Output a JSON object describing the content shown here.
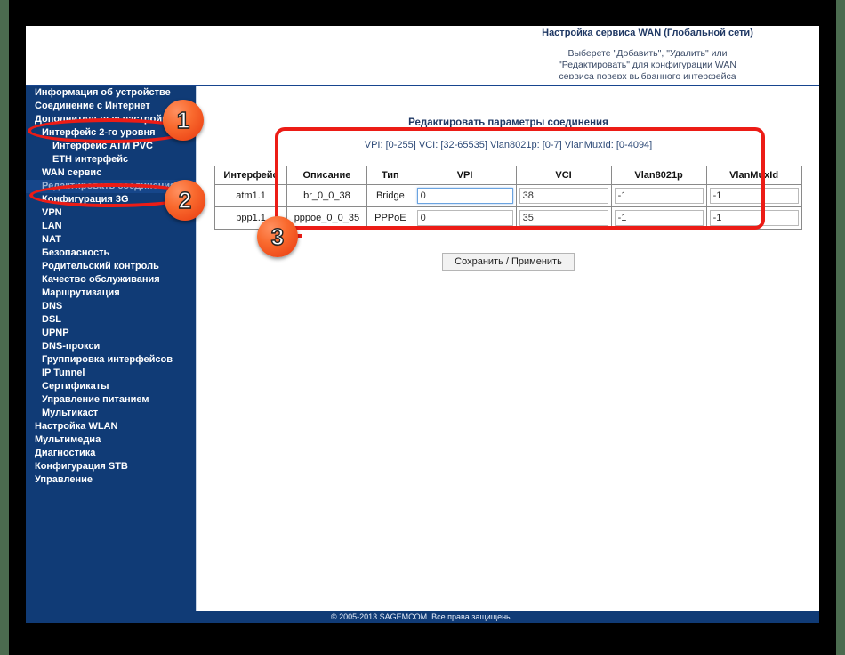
{
  "header": {
    "title": "Настройка сервиса WAN (Глобальной сети)",
    "subtitle_line1": "Выберете \"Добавить\", \"Удалить\" или",
    "subtitle_line2": "\"Редактировать\" для конфигурации WAN",
    "subtitle_line3": "сервиса поверх выбранного интерфейса"
  },
  "sidebar": {
    "items": [
      {
        "label": "Информация об устройстве",
        "level": 0,
        "current": false
      },
      {
        "label": "Соединение с Интернет",
        "level": 0,
        "current": false
      },
      {
        "label": "Дополнительные настройки",
        "level": 0,
        "current": false
      },
      {
        "label": "Интерфейс 2-го уровня",
        "level": 1,
        "current": false
      },
      {
        "label": "Интерфейс ATM PVC",
        "level": 2,
        "current": false
      },
      {
        "label": "ETH интерфейс",
        "level": 2,
        "current": false
      },
      {
        "label": "WAN сервис",
        "level": 1,
        "current": false
      },
      {
        "label": "Редактировать соединения",
        "level": 1,
        "current": true
      },
      {
        "label": "Конфигурация 3G",
        "level": 1,
        "current": false
      },
      {
        "label": "VPN",
        "level": 1,
        "current": false
      },
      {
        "label": "LAN",
        "level": 1,
        "current": false
      },
      {
        "label": "NAT",
        "level": 1,
        "current": false
      },
      {
        "label": "Безопасность",
        "level": 1,
        "current": false
      },
      {
        "label": "Родительский контроль",
        "level": 1,
        "current": false
      },
      {
        "label": "Качество обслуживания",
        "level": 1,
        "current": false
      },
      {
        "label": "Маршрутизация",
        "level": 1,
        "current": false
      },
      {
        "label": "DNS",
        "level": 1,
        "current": false
      },
      {
        "label": "DSL",
        "level": 1,
        "current": false
      },
      {
        "label": "UPNP",
        "level": 1,
        "current": false
      },
      {
        "label": "DNS-прокси",
        "level": 1,
        "current": false
      },
      {
        "label": "Группировка интерфейсов",
        "level": 1,
        "current": false
      },
      {
        "label": "IP Tunnel",
        "level": 1,
        "current": false
      },
      {
        "label": "Сертификаты",
        "level": 1,
        "current": false
      },
      {
        "label": "Управление питанием",
        "level": 1,
        "current": false
      },
      {
        "label": "Мультикаст",
        "level": 1,
        "current": false
      },
      {
        "label": "Настройка WLAN",
        "level": 0,
        "current": false
      },
      {
        "label": "Мультимедиа",
        "level": 0,
        "current": false
      },
      {
        "label": "Диагностика",
        "level": 0,
        "current": false
      },
      {
        "label": "Конфигурация STB",
        "level": 0,
        "current": false
      },
      {
        "label": "Управление",
        "level": 0,
        "current": false
      }
    ]
  },
  "main": {
    "title": "Редактировать параметры соединения",
    "hint": "VPI: [0-255] VCI: [32-65535] Vlan8021p: [0-7] VlanMuxId: [0-4094]",
    "table": {
      "headers": [
        "Интерфейс",
        "Описание",
        "Тип",
        "VPI",
        "VCI",
        "Vlan8021p",
        "VlanMuxId"
      ],
      "rows": [
        {
          "interface": "atm1.1",
          "description": "br_0_0_38",
          "type": "Bridge",
          "vpi": "0",
          "vci": "38",
          "vlan8021p": "-1",
          "vlanmuxid": "-1",
          "vpi_focused": true
        },
        {
          "interface": "ppp1.1",
          "description": "pppoe_0_0_35",
          "type": "PPPoE",
          "vpi": "0",
          "vci": "35",
          "vlan8021p": "-1",
          "vlanmuxid": "-1",
          "vpi_focused": false
        }
      ]
    },
    "save_label": "Сохранить / Применить"
  },
  "footer": {
    "copyright": "© 2005-2013 SAGEMCOM. Все права защищены."
  },
  "annotations": {
    "badge1": "1",
    "badge2": "2",
    "badge3": "3"
  },
  "colors": {
    "sidebar_bg": "#103b76",
    "accent_red": "#ec1c16",
    "badge_orange": "#f96a2e",
    "header_blue": "#1f3864",
    "page_bg": "#ffffff",
    "outer_bg": "#000000",
    "edge_green": "#4b6b4f"
  }
}
